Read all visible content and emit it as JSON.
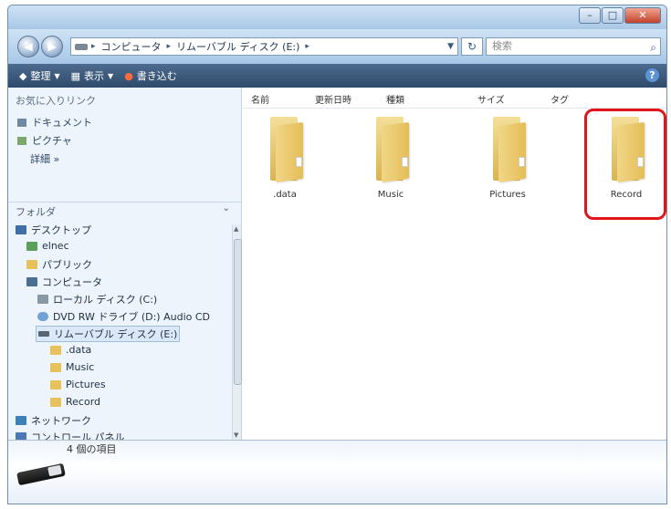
{
  "window": {
    "controls": {
      "minimize": "–",
      "maximize": "□",
      "close": "✕"
    }
  },
  "address": {
    "back_icon": "back-arrow-icon",
    "forward_icon": "forward-arrow-icon",
    "breadcrumbs": [
      "コンピュータ",
      "リムーバブル ディスク (E:)"
    ],
    "search_placeholder": "検索"
  },
  "toolbar": {
    "organize": "整理",
    "views": "表示",
    "burn": "書き込む"
  },
  "favorites": {
    "title": "お気に入りリンク",
    "items": [
      "ドキュメント",
      "ピクチャ"
    ],
    "more": "詳細 »"
  },
  "folders": {
    "title": "フォルダ",
    "tree": [
      {
        "label": "デスクトップ"
      },
      {
        "label": "elnec"
      },
      {
        "label": "パブリック"
      },
      {
        "label": "コンピュータ"
      },
      {
        "label": "ローカル ディスク (C:)"
      },
      {
        "label": "DVD RW ドライブ (D:) Audio CD"
      },
      {
        "label": "リムーバブル ディスク (E:)"
      },
      {
        "label": ".data"
      },
      {
        "label": "Music"
      },
      {
        "label": "Pictures"
      },
      {
        "label": "Record"
      },
      {
        "label": "ネットワーク"
      },
      {
        "label": "コントロール パネル"
      }
    ]
  },
  "columns": [
    "名前",
    "更新日時",
    "種類",
    "サイズ",
    "タグ"
  ],
  "items": [
    {
      "name": ".data"
    },
    {
      "name": "Music"
    },
    {
      "name": "Pictures"
    },
    {
      "name": "Record",
      "highlighted": true
    }
  ],
  "status": {
    "count": "4 個の項目"
  },
  "colors": {
    "highlight": "#e2151b",
    "folder": "#e7c25a",
    "toolbar": "#2f4a6b"
  }
}
